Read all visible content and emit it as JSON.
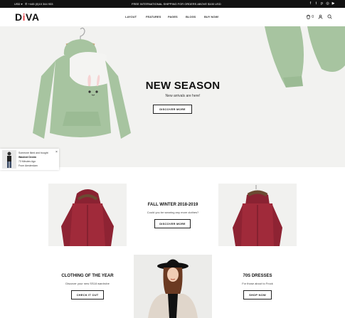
{
  "topbar": {
    "currency": "USD",
    "phone": "+445 (0)10 344 933",
    "shipping_notice": "FREE INTERNATIONAL SHIPPING FOR ORDERS ABOVE $100 USD",
    "social_icons": [
      "facebook-icon",
      "twitter-icon",
      "pinterest-icon",
      "instagram-icon",
      "youtube-icon"
    ]
  },
  "header": {
    "logo": "DiVA",
    "nav": [
      "LAYOUT",
      "FEATURES",
      "PAGES",
      "BLOGS",
      "BUY NOW!"
    ],
    "cart_count": "0"
  },
  "hero": {
    "title": "NEW SEASON",
    "subtitle": "New arrivals are here!",
    "button": "DISCOVER MORE"
  },
  "notification": {
    "line1": "Someone liked and bought",
    "product": "Washed Denim",
    "time": "73 Minutes Ago",
    "location": "From Amsterdam"
  },
  "collections": [
    {
      "title": "FALL WINTER 2018-2019",
      "subtitle": "Could you be wearing any more clothes?",
      "button": "DISCOVER MORE"
    },
    {
      "title": "CLOTHING OF THE YEAR",
      "subtitle": "Discover your new SS18 wardrobe",
      "button": "CHECK IT OUT"
    },
    {
      "title": "70S DRESSES",
      "subtitle": "For those about to Frock",
      "button": "SHOP NOW"
    }
  ],
  "colors": {
    "accent": "#e8454a",
    "hoodie": "#a7c4a0",
    "jacket": "#a02a3a"
  }
}
